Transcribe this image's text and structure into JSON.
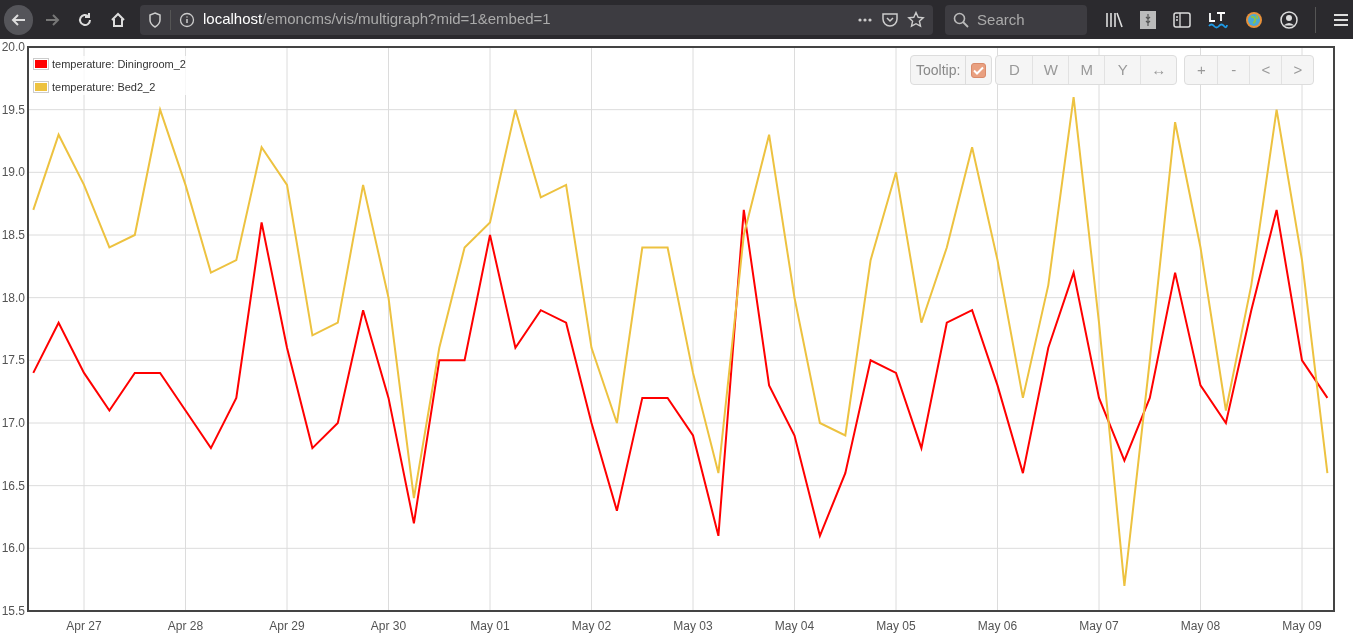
{
  "browser": {
    "url_host": "localhost",
    "url_path": "/emoncms/vis/multigraph?mid=1&embed=1",
    "search": {
      "placeholder": "Search"
    }
  },
  "graph": {
    "tooltip": {
      "label": "Tooltip:",
      "checked": true
    },
    "range_buttons": [
      "D",
      "W",
      "M",
      "Y",
      "↔"
    ],
    "nav_buttons": [
      "+",
      "-",
      "<",
      ">"
    ],
    "chart_data": {
      "type": "line",
      "grid": true,
      "ylim": [
        15.5,
        20.0
      ],
      "categories": [
        null,
        null,
        "Apr 27",
        null,
        null,
        null,
        "Apr 28",
        null,
        null,
        null,
        "Apr 29",
        null,
        null,
        null,
        "Apr 30",
        null,
        null,
        null,
        "May 01",
        null,
        null,
        null,
        "May 02",
        null,
        null,
        null,
        "May 03",
        null,
        null,
        null,
        "May 04",
        null,
        null,
        null,
        "May 05",
        null,
        null,
        null,
        "May 06",
        null,
        null,
        null,
        "May 07",
        null,
        null,
        null,
        "May 08",
        null,
        null,
        null,
        "May 09",
        null
      ],
      "yticks": [
        {
          "value": 15.5,
          "label": "15.5"
        },
        {
          "value": 16,
          "label": "16.0"
        },
        {
          "value": 16.5,
          "label": "16.5"
        },
        {
          "value": 17,
          "label": "17.0"
        },
        {
          "value": 17.5,
          "label": "17.5"
        },
        {
          "value": 18,
          "label": "18.0"
        },
        {
          "value": 18.5,
          "label": "18.5"
        },
        {
          "value": 19,
          "label": "19.0"
        },
        {
          "value": 19.5,
          "label": "19.5"
        },
        {
          "value": 20,
          "label": "20.0"
        }
      ],
      "series": [
        {
          "name": "temperature: Diningroom_2",
          "color": "#ff0000",
          "values": [
            17.4,
            17.8,
            17.4,
            17.1,
            17.4,
            17.4,
            17.1,
            16.8,
            17.2,
            18.6,
            17.6,
            16.8,
            17.0,
            17.9,
            17.2,
            16.2,
            17.5,
            17.5,
            18.5,
            17.6,
            17.9,
            17.8,
            17.0,
            16.3,
            17.2,
            17.2,
            16.9,
            16.1,
            18.7,
            17.3,
            16.9,
            16.1,
            16.6,
            17.5,
            17.4,
            16.8,
            17.8,
            17.9,
            17.3,
            16.6,
            17.6,
            18.2,
            17.2,
            16.7,
            17.2,
            18.2,
            17.3,
            17.0,
            17.9,
            18.7,
            17.5,
            17.2
          ]
        },
        {
          "name": "temperature: Bed2_2",
          "color": "#edc240",
          "values": [
            18.7,
            19.3,
            18.9,
            18.4,
            18.5,
            19.5,
            18.9,
            18.2,
            18.3,
            19.2,
            18.9,
            17.7,
            17.8,
            18.9,
            18.0,
            16.4,
            17.6,
            18.4,
            18.6,
            19.5,
            18.8,
            18.9,
            17.6,
            17.0,
            18.4,
            18.4,
            17.4,
            16.6,
            18.5,
            19.3,
            18.0,
            17.0,
            16.9,
            18.3,
            19.0,
            17.8,
            18.4,
            19.2,
            18.3,
            17.2,
            18.1,
            19.6,
            17.8,
            15.7,
            17.5,
            19.4,
            18.4,
            17.1,
            18.1,
            19.5,
            18.3,
            16.6
          ]
        }
      ]
    }
  }
}
